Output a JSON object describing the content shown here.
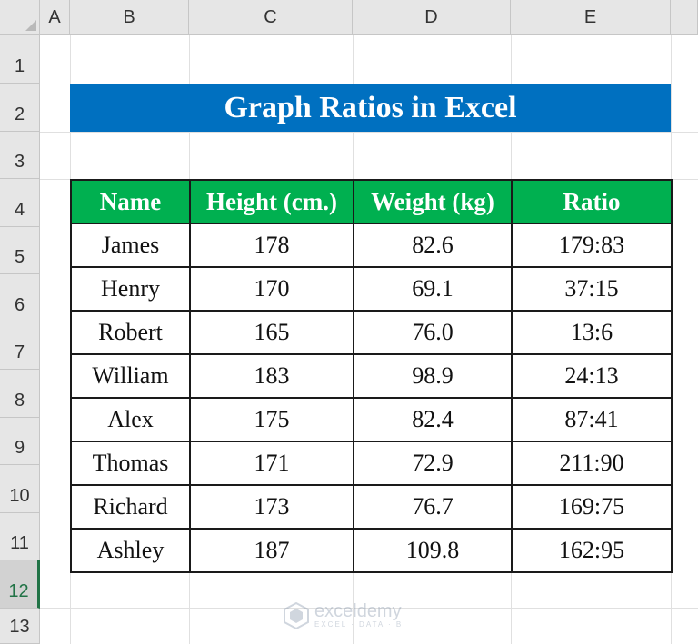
{
  "columns": [
    "A",
    "B",
    "C",
    "D",
    "E"
  ],
  "rows": [
    "1",
    "2",
    "3",
    "4",
    "5",
    "6",
    "7",
    "8",
    "9",
    "10",
    "11",
    "12",
    "13"
  ],
  "selected_row": "12",
  "title": "Graph Ratios in Excel",
  "table": {
    "headers": [
      "Name",
      "Height (cm.)",
      "Weight (kg)",
      "Ratio"
    ],
    "rows": [
      [
        "James",
        "178",
        "82.6",
        "179:83"
      ],
      [
        "Henry",
        "170",
        "69.1",
        "37:15"
      ],
      [
        "Robert",
        "165",
        "76.0",
        "13:6"
      ],
      [
        "William",
        "183",
        "98.9",
        "24:13"
      ],
      [
        "Alex",
        "175",
        "82.4",
        "87:41"
      ],
      [
        "Thomas",
        "171",
        "72.9",
        "211:90"
      ],
      [
        "Richard",
        "173",
        "76.7",
        "169:75"
      ],
      [
        "Ashley",
        "187",
        "109.8",
        "162:95"
      ]
    ]
  },
  "watermark": {
    "name": "exceldemy",
    "tagline": "EXCEL · DATA · BI"
  },
  "colors": {
    "title_bg": "#0070c0",
    "header_bg": "#00b050",
    "selection": "#217346"
  }
}
